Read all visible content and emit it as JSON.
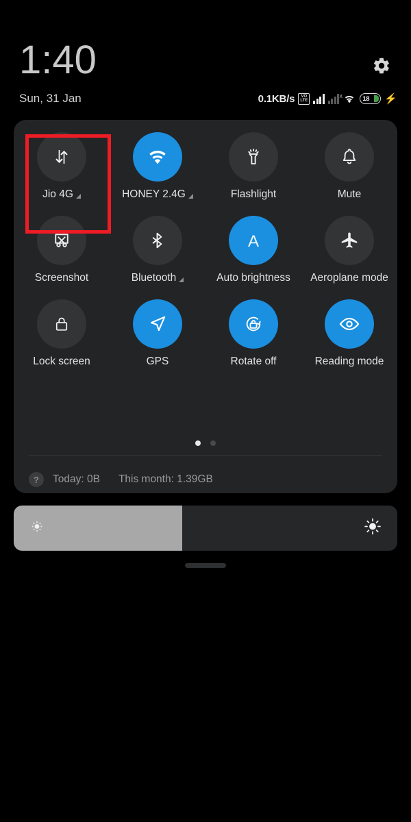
{
  "status_bar": {
    "time": "1:40",
    "date": "Sun, 31 Jan",
    "network_speed": "0.1KB/s",
    "volte_top": "VO",
    "volte_bottom": "LTE",
    "sim2_x": "x",
    "battery_level": "18",
    "charging_bolt": "⚡",
    "settings_icon": "gear-icon"
  },
  "quick_settings": {
    "tiles": [
      {
        "label": "Jio 4G",
        "icon": "mobile-data-icon",
        "active": false,
        "has_caret": true
      },
      {
        "label": "HONEY 2.4G",
        "icon": "wifi-icon",
        "active": true,
        "has_caret": true
      },
      {
        "label": "Flashlight",
        "icon": "flashlight-icon",
        "active": false,
        "has_caret": false
      },
      {
        "label": "Mute",
        "icon": "bell-icon",
        "active": false,
        "has_caret": false
      },
      {
        "label": "Screenshot",
        "icon": "screenshot-icon",
        "active": false,
        "has_caret": false
      },
      {
        "label": "Bluetooth",
        "icon": "bluetooth-icon",
        "active": false,
        "has_caret": true
      },
      {
        "label": "Auto brightness",
        "icon": "auto-brightness-icon",
        "active": true,
        "has_caret": false
      },
      {
        "label": "Aeroplane mode",
        "icon": "aeroplane-icon",
        "active": false,
        "has_caret": false
      },
      {
        "label": "Lock screen",
        "icon": "lock-icon",
        "active": false,
        "has_caret": false
      },
      {
        "label": "GPS",
        "icon": "location-arrow-icon",
        "active": true,
        "has_caret": false
      },
      {
        "label": "Rotate off",
        "icon": "rotate-lock-icon",
        "active": true,
        "has_caret": false
      },
      {
        "label": "Reading mode",
        "icon": "eye-icon",
        "active": true,
        "has_caret": false
      }
    ],
    "pages": {
      "count": 2,
      "current": 1
    },
    "data_usage": {
      "help_icon": "?",
      "today": "Today: 0B",
      "this_month": "This month: 1.39GB"
    }
  },
  "brightness": {
    "level_percent": 44,
    "low_icon": "brightness-low-icon",
    "high_icon": "brightness-high-icon"
  },
  "annotation": {
    "highlight_target": "Jio 4G",
    "color": "#ee1c25"
  },
  "colors": {
    "accent_active": "#1b8fe0",
    "tile_inactive": "#333436",
    "panel_bg": "#232426",
    "battery_green": "#43a047"
  }
}
